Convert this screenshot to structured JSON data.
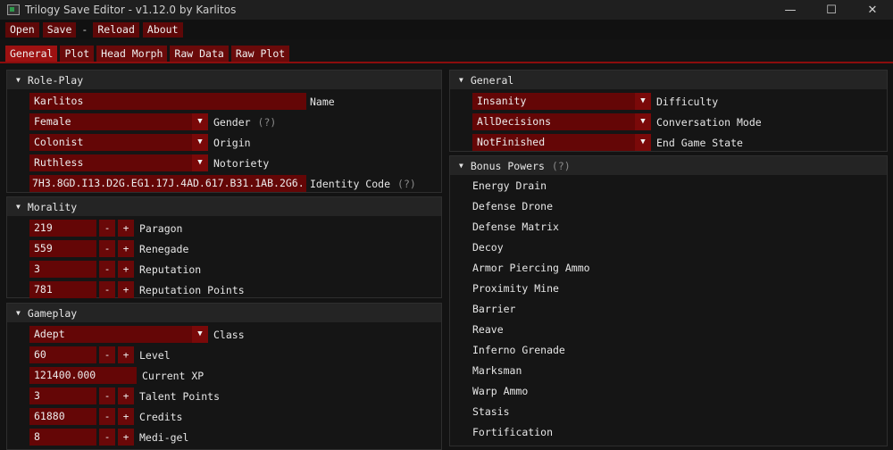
{
  "window": {
    "title": "Trilogy Save Editor - v1.12.0 by Karlitos",
    "minimize": "—",
    "maximize": "☐",
    "close": "✕"
  },
  "menu": {
    "open": "Open",
    "save": "Save",
    "separator": "-",
    "reload": "Reload",
    "about": "About"
  },
  "tabs": [
    "General",
    "Plot",
    "Head Morph",
    "Raw Data",
    "Raw Plot"
  ],
  "roleplay": {
    "header": "Role-Play",
    "name_value": "Karlitos",
    "name_label": "Name",
    "gender_value": "Female",
    "gender_label": "Gender",
    "gender_hint": "(?)",
    "origin_value": "Colonist",
    "origin_label": "Origin",
    "notoriety_value": "Ruthless",
    "notoriety_label": "Notoriety",
    "identity_value": "7H3.8GD.I13.D2G.EG1.17J.4AD.617.B31.1AB.2G6.",
    "identity_label": "Identity Code",
    "identity_hint": "(?)"
  },
  "morality": {
    "header": "Morality",
    "rows": [
      {
        "value": "219",
        "label": "Paragon"
      },
      {
        "value": "559",
        "label": "Renegade"
      },
      {
        "value": "3",
        "label": "Reputation"
      },
      {
        "value": "781",
        "label": "Reputation Points"
      }
    ]
  },
  "gameplay": {
    "header": "Gameplay",
    "class_value": "Adept",
    "class_label": "Class",
    "level_value": "60",
    "level_label": "Level",
    "xp_value": "121400.000",
    "xp_label": "Current XP",
    "talent_value": "3",
    "talent_label": "Talent Points",
    "credits_value": "61880",
    "credits_label": "Credits",
    "medigel_value": "8",
    "medigel_label": "Medi-gel"
  },
  "general": {
    "header": "General",
    "difficulty_value": "Insanity",
    "difficulty_label": "Difficulty",
    "conversation_value": "AllDecisions",
    "conversation_label": "Conversation Mode",
    "endgame_value": "NotFinished",
    "endgame_label": "End Game State"
  },
  "bonus_powers": {
    "header": "Bonus Powers",
    "hint": "(?)",
    "items": [
      "Energy Drain",
      "Defense Drone",
      "Defense Matrix",
      "Decoy",
      "Armor Piercing Ammo",
      "Proximity Mine",
      "Barrier",
      "Reave",
      "Inferno Grenade",
      "Marksman",
      "Warp Ammo",
      "Stasis",
      "Fortification"
    ]
  },
  "stepper": {
    "minus": "-",
    "plus": "+"
  },
  "icons": {
    "collapse": "triangle-down-icon",
    "dropdown": "triangle-down-icon"
  },
  "colors": {
    "accent": "#640606",
    "tab_active": "#9d1111",
    "background": "#131313"
  }
}
